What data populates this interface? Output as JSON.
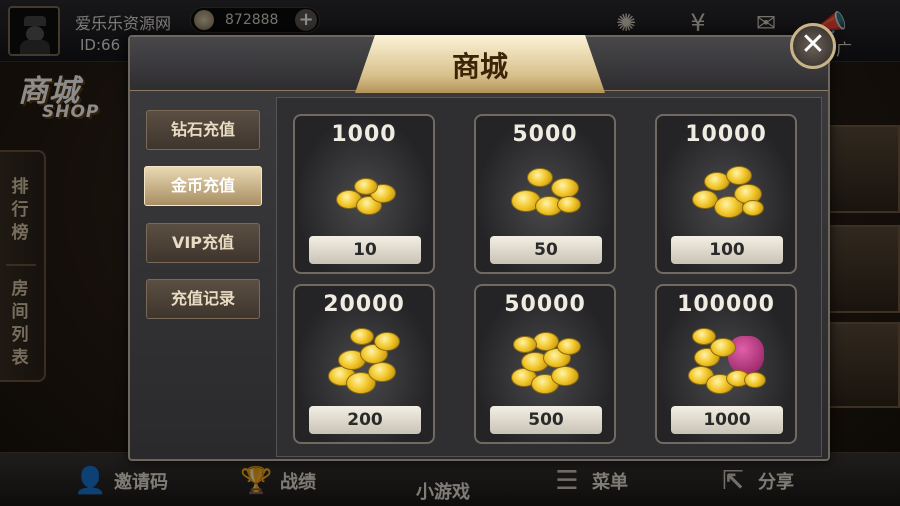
{
  "app": {
    "player_name": "爱乐乐资源网",
    "player_id": "ID:66",
    "coin_balance": "872888",
    "plus_label": "+",
    "shop_logo": "商城",
    "shop_logo_en": "SHOP"
  },
  "left_tabs": [
    "排",
    "行",
    "榜",
    "房",
    "间",
    "列",
    "表"
  ],
  "topbar_icons": [
    "settings-icon",
    "yen-icon",
    "mail-icon",
    "megaphone-icon"
  ],
  "topbar_partial_text": "广",
  "bottom_bar": [
    {
      "label": "邀请码",
      "icon": "person-check-icon"
    },
    {
      "label": "战绩",
      "icon": "trophy-icon"
    },
    {
      "label": "小游戏",
      "icon": ""
    },
    {
      "label": "菜单",
      "icon": "menu-icon"
    },
    {
      "label": "分享",
      "icon": "share-icon"
    }
  ],
  "dialog": {
    "title": "商城",
    "close_label": "✕",
    "categories": [
      {
        "label": "钻石充值",
        "active": false
      },
      {
        "label": "金币充值",
        "active": true
      },
      {
        "label": "VIP充值",
        "active": false
      },
      {
        "label": "充值记录",
        "active": false
      }
    ],
    "packages": [
      {
        "amount": "1000",
        "price": "10",
        "tier": 1
      },
      {
        "amount": "5000",
        "price": "50",
        "tier": 2
      },
      {
        "amount": "10000",
        "price": "100",
        "tier": 3
      },
      {
        "amount": "20000",
        "price": "200",
        "tier": 4
      },
      {
        "amount": "50000",
        "price": "500",
        "tier": 5
      },
      {
        "amount": "100000",
        "price": "1000",
        "tier": 6
      }
    ]
  },
  "colors": {
    "gold": "#f2c72a",
    "plaque": "#d8c08c",
    "dialog_bg": "#2a2a2c",
    "active_tab": "#e9d9b4"
  }
}
